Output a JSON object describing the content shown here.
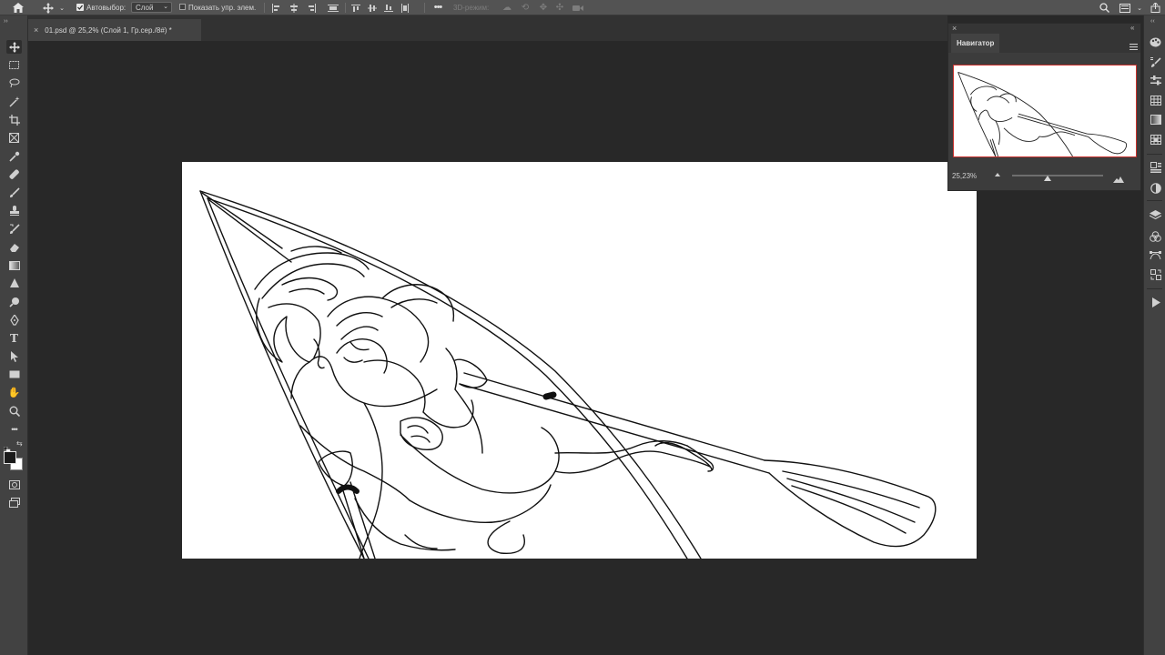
{
  "options_bar": {
    "autoselect_label": "Автовыбор:",
    "autoselect_value": "Слой",
    "show_transform_label": "Показать упр. элем.",
    "mode_3d_label": "3D-режим:",
    "more_icon": "ellipsis-icon"
  },
  "document_tab": {
    "title": "01.psd @ 25,2% (Слой 1, Гр.сер./8#) *",
    "close_glyph": "×"
  },
  "navigator": {
    "title": "Навигатор",
    "zoom": "25,23%",
    "close_glyph": "×",
    "collapse_glyph": "«"
  },
  "colors": {
    "ui_dark": "#282828",
    "panel": "#424242",
    "options_bar": "#535353",
    "view_box": "#c9312d",
    "canvas": "#ffffff"
  },
  "tools_left": [
    "move-icon",
    "marquee-icon",
    "lasso-icon",
    "magic-wand-icon",
    "crop-icon",
    "frame-icon",
    "eyedropper-icon",
    "healing-icon",
    "brush-icon",
    "stamp-icon",
    "history-brush-icon",
    "eraser-icon",
    "gradient-icon",
    "blur-icon",
    "dodge-icon",
    "pen-icon",
    "type-icon",
    "path-select-icon",
    "rectangle-icon",
    "hand-icon",
    "zoom-icon",
    "more-tools-icon"
  ],
  "tools_right": [
    "color-panel-icon",
    "brushes-icon",
    "adjust-icon",
    "swatches-icon",
    "gradients-icon",
    "patterns-icon",
    "properties-icon",
    "adjustments-icon",
    "layers-icon",
    "channels-icon",
    "paths-icon",
    "history-icon",
    "play-icon"
  ]
}
